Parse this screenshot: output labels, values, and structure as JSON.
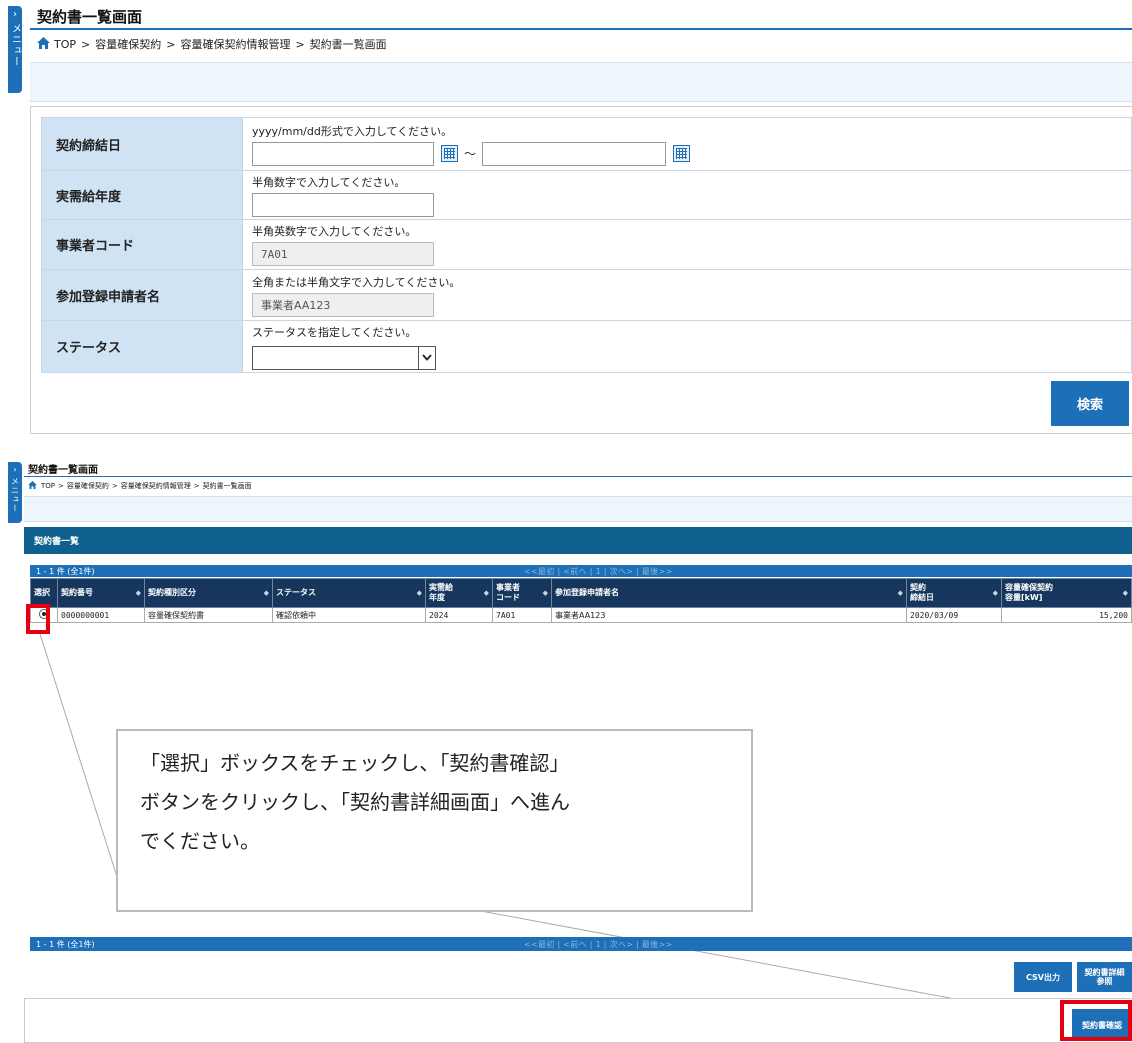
{
  "top": {
    "menu_label": "メニュー",
    "title": "契約書一覧画面",
    "breadcrumb": [
      "TOP",
      "容量確保契約",
      "容量確保契約情報管理",
      "契約書一覧画面"
    ],
    "breadcrumb_sep": ">",
    "form": {
      "contract_date": {
        "label": "契約締結日",
        "hint": "yyyy/mm/dd形式で入力してください。",
        "from": "",
        "to": "",
        "tilde": "～"
      },
      "supply_year": {
        "label": "実需給年度",
        "hint": "半角数字で入力してください。",
        "value": ""
      },
      "operator_code": {
        "label": "事業者コード",
        "hint": "半角英数字で入力してください。",
        "value": "7A01"
      },
      "applicant_name": {
        "label": "参加登録申請者名",
        "hint": "全角または半角文字で入力してください。",
        "value": "事業者AA123"
      },
      "status": {
        "label": "ステータス",
        "hint": "ステータスを指定してください。",
        "value": ""
      }
    },
    "search_button": "検索"
  },
  "bottom": {
    "menu_label": "メニュー",
    "title": "契約書一覧画面",
    "breadcrumb": [
      "TOP",
      "容量確保契約",
      "容量確保契約情報管理",
      "契約書一覧画面"
    ],
    "breadcrumb_sep": ">",
    "list_title": "契約書一覧",
    "pager": {
      "count": "1 - 1 件 (全1件)",
      "nav": "<<最初 | <前へ | 1 | 次へ> | 最後>>"
    },
    "columns": [
      "選択",
      "契約番号",
      "契約種別区分",
      "ステータス",
      "実需給\n年度",
      "事業者\nコード",
      "参加登録申請者名",
      "契約\n締結日",
      "容量確保契約\n容量[kW]"
    ],
    "rows": [
      {
        "contract_no": "0000000001",
        "type": "容量確保契約書",
        "status": "確認依頼中",
        "year": "2024",
        "code": "7A01",
        "applicant": "事業者AA123",
        "date": "2020/03/09",
        "capacity": "15,200"
      }
    ],
    "callout": [
      "「選択」ボックスをチェックし、「契約書確認」",
      "ボタンをクリックし、「契約書詳細画面」へ進ん",
      "でください。"
    ],
    "csv_button": "CSV出力",
    "detail_button": "契約書詳細\n参照",
    "confirm_button": "契約書確認"
  },
  "colors": {
    "primary": "#1d6fb8",
    "header_dark": "#17365d",
    "label_bg": "#cfe3f4",
    "highlight": "#e60012"
  }
}
